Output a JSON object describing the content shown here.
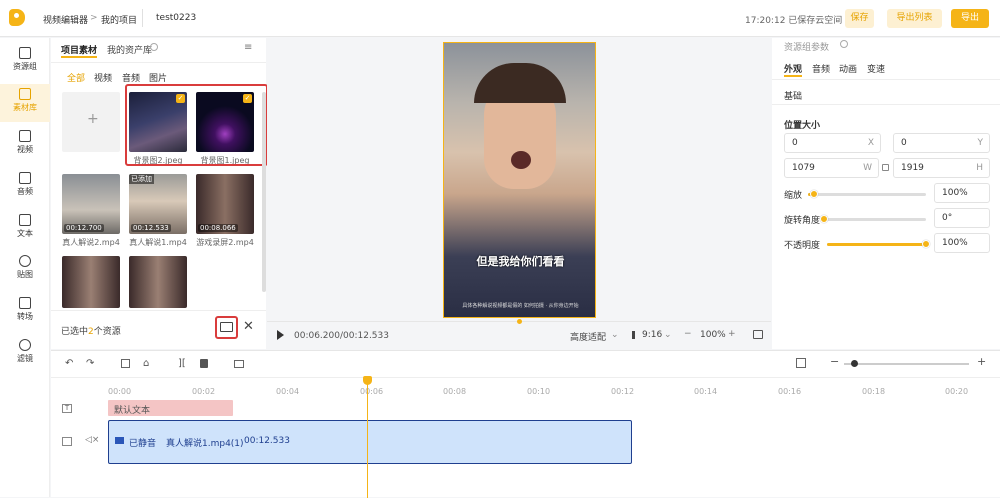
{
  "topbar": {
    "crumbs": [
      "视频编辑器",
      "我的项目",
      "test0223"
    ],
    "crumb_sep": ">",
    "save_status": "17:20:12 已保存云空间",
    "save_label": "保存",
    "export_list_label": "导出列表",
    "export_label": "导出"
  },
  "leftnav": [
    {
      "label": "资源组",
      "icon": "folder-icon"
    },
    {
      "label": "素材库",
      "icon": "media-library-icon"
    },
    {
      "label": "视频",
      "icon": "film-icon"
    },
    {
      "label": "音频",
      "icon": "music-icon"
    },
    {
      "label": "文本",
      "icon": "text-icon"
    },
    {
      "label": "贴图",
      "icon": "sticker-icon"
    },
    {
      "label": "转场",
      "icon": "transition-icon"
    },
    {
      "label": "滤镜",
      "icon": "filter-icon"
    }
  ],
  "panel": {
    "tabs": [
      "项目素材",
      "我的资产库"
    ],
    "filters": [
      "全部",
      "视频",
      "音频",
      "图片"
    ],
    "add_symbol": "+",
    "assets": [
      {
        "name": "背景图2.jpeg",
        "checked": "✓",
        "duration": ""
      },
      {
        "name": "背景图1.jpeg",
        "checked": "✓",
        "duration": ""
      },
      {
        "name": "真人解说2.mp4",
        "duration": "00:12.700"
      },
      {
        "name": "真人解说1.mp4",
        "duration": "00:12.533",
        "badge": "已添加"
      },
      {
        "name": "游戏录屏2.mp4",
        "duration": "00:08.066"
      }
    ],
    "selected_prefix": "已选中",
    "selected_count": "2",
    "selected_suffix": "个资源"
  },
  "preview": {
    "subtitle": "但是我给你们看看",
    "small_caption": "具体各种解说视频都是假的 如何拍摄 · 从你身边开始",
    "time": "00:06.200/00:12.533",
    "fit": "高度适配",
    "ratio": "9:16",
    "zoom": "100%"
  },
  "props": {
    "header": "资源组参数",
    "tabs": [
      "外观",
      "音频",
      "动画",
      "变速"
    ],
    "basic": "基础",
    "pos_size": "位置大小",
    "x": "0",
    "x_unit": "X",
    "y": "0",
    "y_unit": "Y",
    "w": "1079",
    "w_unit": "W",
    "h": "1919",
    "h_unit": "H",
    "scale_label": "缩放",
    "scale_value": "100%",
    "scale_level": 0.05,
    "rotate_label": "旋转角度",
    "rotate_value": "0°",
    "rotate_level": 0.0,
    "opacity_label": "不透明度",
    "opacity_value": "100%",
    "opacity_level": 1.0
  },
  "timeline": {
    "ticks": [
      "00:00",
      "00:02",
      "00:04",
      "00:06",
      "00:08",
      "00:10",
      "00:12",
      "00:14",
      "00:16",
      "00:18",
      "00:20"
    ],
    "text_clip": "默认文本",
    "video_clip": {
      "mute": "已静音",
      "name": "真人解说1.mp4(1)",
      "duration": "00:12.533"
    },
    "zoom_minus": "−",
    "zoom_plus": "+"
  },
  "colors": {
    "accent": "#f5b417",
    "export": "#f5b417",
    "text_clip": "#f4c5c5",
    "video_clip": "#cfe3fb",
    "clip_border": "#1f3f8f"
  }
}
